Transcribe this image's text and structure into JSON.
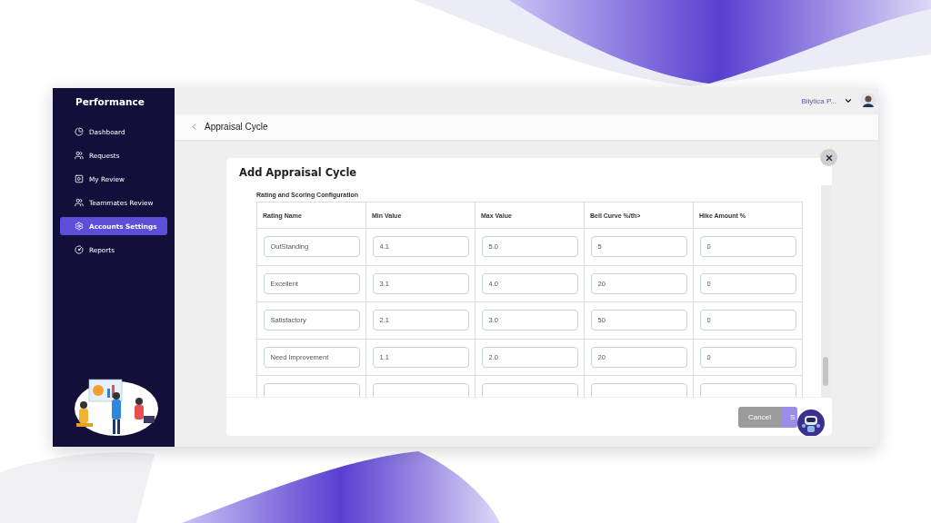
{
  "sidebar": {
    "title": "Performance",
    "items": [
      {
        "label": "Dashboard",
        "kind": "chart",
        "selected": false
      },
      {
        "label": "Requests",
        "kind": "people",
        "selected": false
      },
      {
        "label": "My Review",
        "kind": "screen",
        "selected": false
      },
      {
        "label": "Teammates Review",
        "kind": "people",
        "selected": false
      },
      {
        "label": "Accounts Settings",
        "kind": "gear",
        "selected": true
      },
      {
        "label": "Reports",
        "kind": "report",
        "selected": false
      }
    ]
  },
  "topbar": {
    "user_name": "Bilytica P..."
  },
  "header": {
    "title": "Appraisal Cycle"
  },
  "modal": {
    "title": "Add Appraisal Cycle",
    "section_title": "Rating and Scoring Configuration",
    "table": {
      "columns": [
        "Rating Name",
        "Min Value",
        "Max Value",
        "Bell Curve %/th>",
        "Hike Amount %"
      ],
      "rows": [
        [
          "OutStanding",
          "4.1",
          "5.0",
          "5",
          "0"
        ],
        [
          "Excellent",
          "3.1",
          "4.0",
          "20",
          "0"
        ],
        [
          "Satisfactory",
          "2.1",
          "3.0",
          "50",
          "0"
        ],
        [
          "Need Improvement",
          "1.1",
          "2.0",
          "20",
          "0"
        ]
      ]
    },
    "buttons": [
      {
        "label": "Cancel",
        "kind": "secondary"
      },
      {
        "label": "S",
        "kind": "primary"
      }
    ]
  }
}
